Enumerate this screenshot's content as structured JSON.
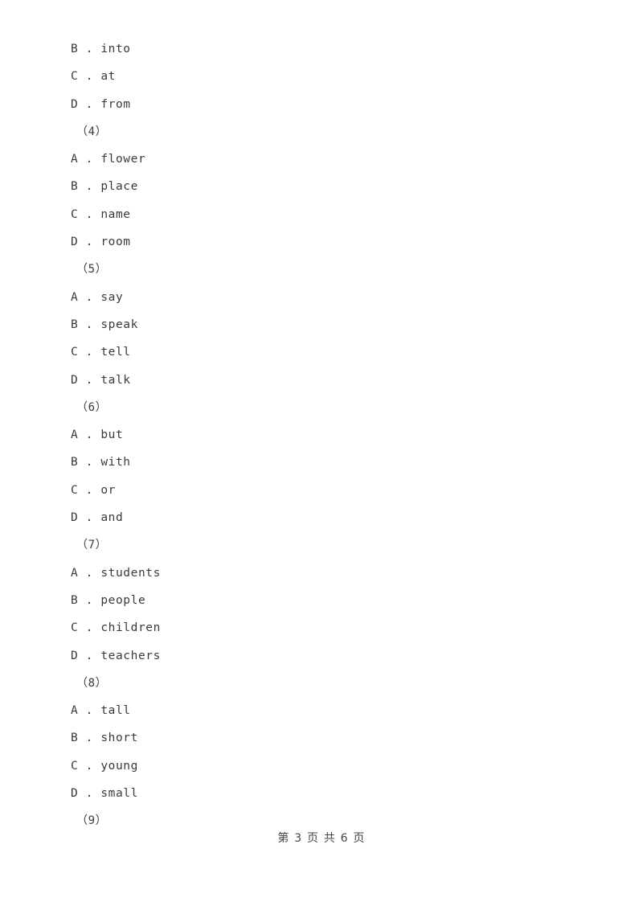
{
  "document": {
    "type": "exam-paper",
    "text_color": "#3a3a3a",
    "background_color": "#ffffff"
  },
  "lines": [
    {
      "kind": "option",
      "text": "B . into"
    },
    {
      "kind": "option",
      "text": "C . at"
    },
    {
      "kind": "option",
      "text": "D . from"
    },
    {
      "kind": "group",
      "text": "（4）"
    },
    {
      "kind": "option",
      "text": "A . flower"
    },
    {
      "kind": "option",
      "text": "B . place"
    },
    {
      "kind": "option",
      "text": "C . name"
    },
    {
      "kind": "option",
      "text": "D . room"
    },
    {
      "kind": "group",
      "text": "（5）"
    },
    {
      "kind": "option",
      "text": "A . say"
    },
    {
      "kind": "option",
      "text": "B . speak"
    },
    {
      "kind": "option",
      "text": "C . tell"
    },
    {
      "kind": "option",
      "text": "D . talk"
    },
    {
      "kind": "group",
      "text": "（6）"
    },
    {
      "kind": "option",
      "text": "A . but"
    },
    {
      "kind": "option",
      "text": "B . with"
    },
    {
      "kind": "option",
      "text": "C . or"
    },
    {
      "kind": "option",
      "text": "D . and"
    },
    {
      "kind": "group",
      "text": "（7）"
    },
    {
      "kind": "option",
      "text": "A . students"
    },
    {
      "kind": "option",
      "text": "B . people"
    },
    {
      "kind": "option",
      "text": "C . children"
    },
    {
      "kind": "option",
      "text": "D . teachers"
    },
    {
      "kind": "group",
      "text": "（8）"
    },
    {
      "kind": "option",
      "text": "A . tall"
    },
    {
      "kind": "option",
      "text": "B . short"
    },
    {
      "kind": "option",
      "text": "C . young"
    },
    {
      "kind": "option",
      "text": "D . small"
    },
    {
      "kind": "group",
      "text": "（9）"
    }
  ],
  "footer": {
    "text": "第 3 页 共 6 页",
    "current_page": "3",
    "total_pages": "6"
  }
}
